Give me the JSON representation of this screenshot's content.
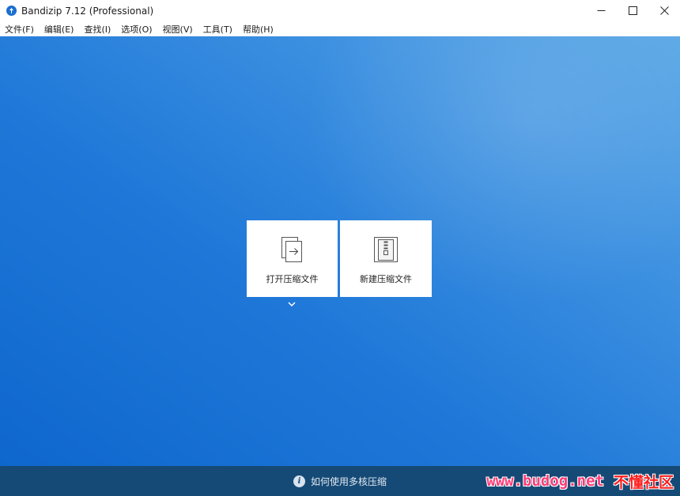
{
  "window": {
    "title": "Bandizip 7.12 (Professional)",
    "controls": [
      "minimize",
      "maximize",
      "close"
    ]
  },
  "menu": {
    "items": [
      "文件(F)",
      "编辑(E)",
      "查找(I)",
      "选项(O)",
      "视图(V)",
      "工具(T)",
      "帮助(H)"
    ]
  },
  "tiles": {
    "open": {
      "label": "打开压缩文件",
      "icon": "open-archive-icon"
    },
    "new": {
      "label": "新建压缩文件",
      "icon": "new-archive-icon"
    }
  },
  "status": {
    "help_text": "如何使用多核压缩",
    "watermark_url": "www.budog.net",
    "watermark_cn": "不懂社区"
  },
  "colors": {
    "main_blue": "#1f78d8",
    "status_bar": "#164a76",
    "watermark_pink": "#ff3c78"
  }
}
